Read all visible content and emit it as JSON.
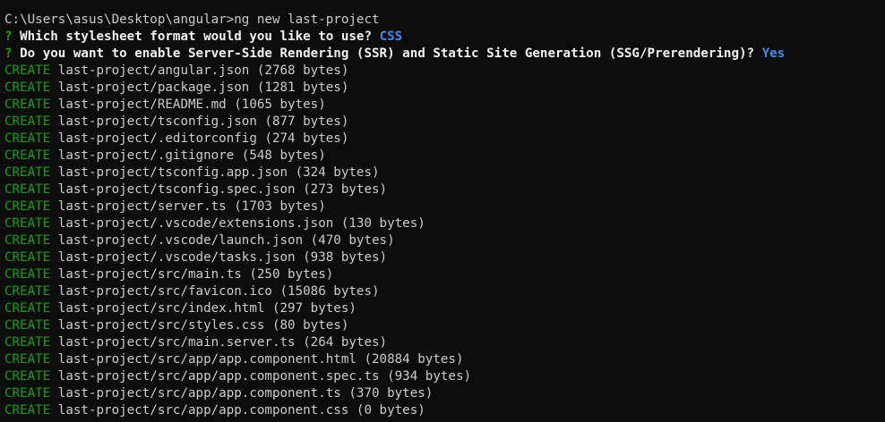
{
  "command_line": {
    "prompt": "C:\\Users\\asus\\Desktop\\angular>",
    "command": "ng new last-project"
  },
  "questions": [
    {
      "marker": "?",
      "text": "Which stylesheet format would you like to use?",
      "answer": "CSS"
    },
    {
      "marker": "?",
      "text": "Do you want to enable Server-Side Rendering (SSR) and Static Site Generation (SSG/Prerendering)?",
      "answer": "Yes"
    }
  ],
  "create_label": "CREATE",
  "created_files": [
    "last-project/angular.json (2768 bytes)",
    "last-project/package.json (1281 bytes)",
    "last-project/README.md (1065 bytes)",
    "last-project/tsconfig.json (877 bytes)",
    "last-project/.editorconfig (274 bytes)",
    "last-project/.gitignore (548 bytes)",
    "last-project/tsconfig.app.json (324 bytes)",
    "last-project/tsconfig.spec.json (273 bytes)",
    "last-project/server.ts (1703 bytes)",
    "last-project/.vscode/extensions.json (130 bytes)",
    "last-project/.vscode/launch.json (470 bytes)",
    "last-project/.vscode/tasks.json (938 bytes)",
    "last-project/src/main.ts (250 bytes)",
    "last-project/src/favicon.ico (15086 bytes)",
    "last-project/src/index.html (297 bytes)",
    "last-project/src/styles.css (80 bytes)",
    "last-project/src/main.server.ts (264 bytes)",
    "last-project/src/app/app.component.html (20884 bytes)",
    "last-project/src/app/app.component.spec.ts (934 bytes)",
    "last-project/src/app/app.component.ts (370 bytes)",
    "last-project/src/app/app.component.css (0 bytes)"
  ],
  "colors": {
    "background": "#0c0c0c",
    "text": "#cccccc",
    "create": "#13a10e",
    "answer": "#3b8eea"
  }
}
